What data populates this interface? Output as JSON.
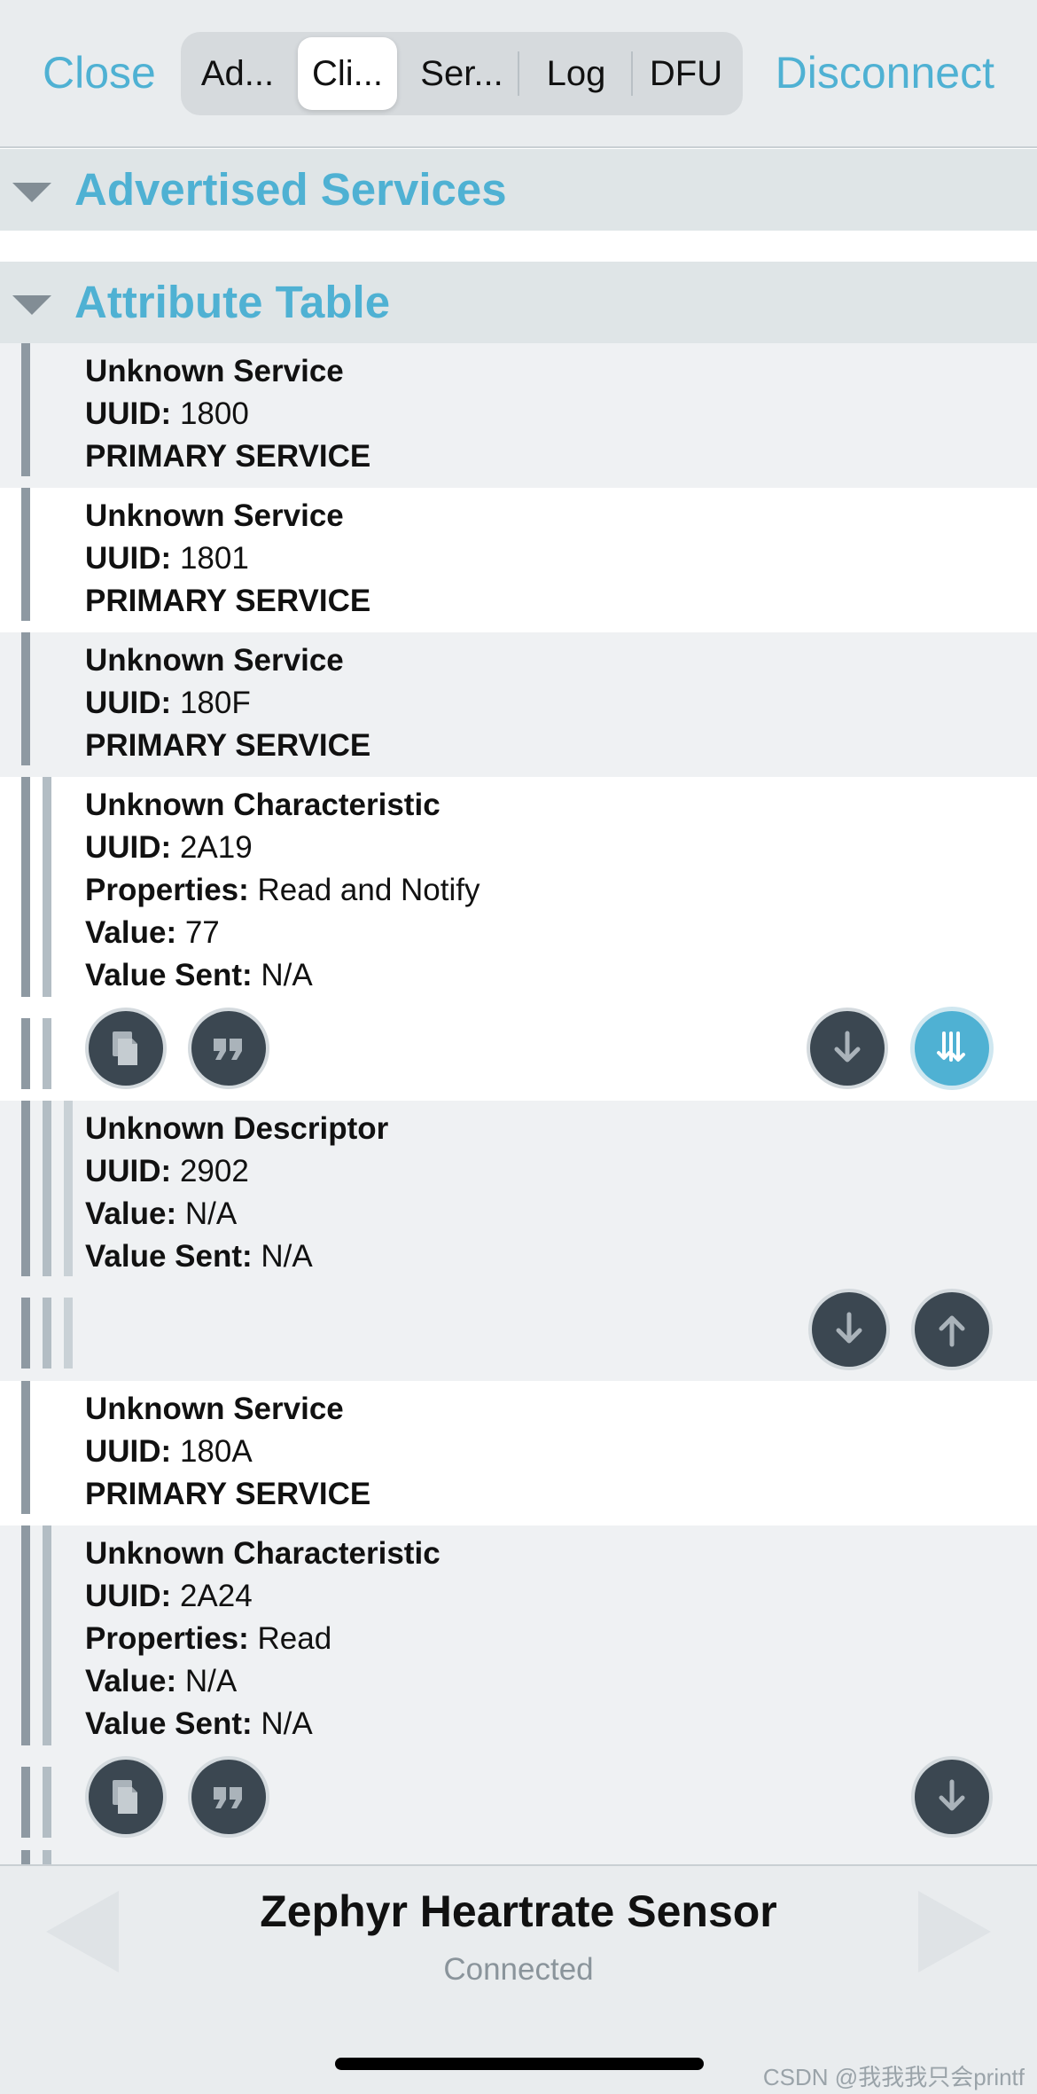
{
  "topbar": {
    "close_label": "Close",
    "disconnect_label": "Disconnect",
    "tabs": [
      {
        "label": "Ad..."
      },
      {
        "label": "Cli...",
        "active": true
      },
      {
        "label": "Ser..."
      },
      {
        "label": "Log"
      },
      {
        "label": "DFU"
      }
    ]
  },
  "sections": {
    "advertised": {
      "title": "Advertised Services",
      "expanded": true
    },
    "attribute": {
      "title": "Attribute Table",
      "expanded": true
    }
  },
  "labels": {
    "uuid": "UUID:",
    "properties": "Properties:",
    "value": "Value:",
    "value_sent": "Value Sent:"
  },
  "attributes": [
    {
      "name": "Unknown Service",
      "uuid": "1800",
      "kind": "PRIMARY SERVICE"
    },
    {
      "name": "Unknown Service",
      "uuid": "1801",
      "kind": "PRIMARY SERVICE"
    },
    {
      "name": "Unknown Service",
      "uuid": "180F",
      "kind": "PRIMARY SERVICE"
    },
    {
      "name": "Unknown Characteristic",
      "uuid": "2A19",
      "properties": "Read and Notify",
      "value": "77",
      "value_sent": "N/A",
      "actions": [
        "copy-icon",
        "quote-icon",
        "read-arrow-down-icon",
        "notify-arrows-icon"
      ],
      "notify_active": true
    },
    {
      "name": "Unknown Descriptor",
      "uuid": "2902",
      "value": "N/A",
      "value_sent": "N/A",
      "actions": [
        "read-arrow-down-icon",
        "write-arrow-up-icon"
      ]
    },
    {
      "name": "Unknown Service",
      "uuid": "180A",
      "kind": "PRIMARY SERVICE"
    },
    {
      "name": "Unknown Characteristic",
      "uuid": "2A24",
      "properties": "Read",
      "value": "N/A",
      "value_sent": "N/A",
      "actions": [
        "copy-icon",
        "quote-icon",
        "read-arrow-down-icon"
      ]
    }
  ],
  "bottombar": {
    "device_name": "Zephyr Heartrate Sensor",
    "status": "Connected"
  },
  "watermark": "CSDN @我我我只会printf",
  "colors": {
    "accent": "#4fb1d3",
    "button_dark": "#3b4751",
    "row_gray": "#eff1f3",
    "header_bg": "#dfe5e7"
  }
}
